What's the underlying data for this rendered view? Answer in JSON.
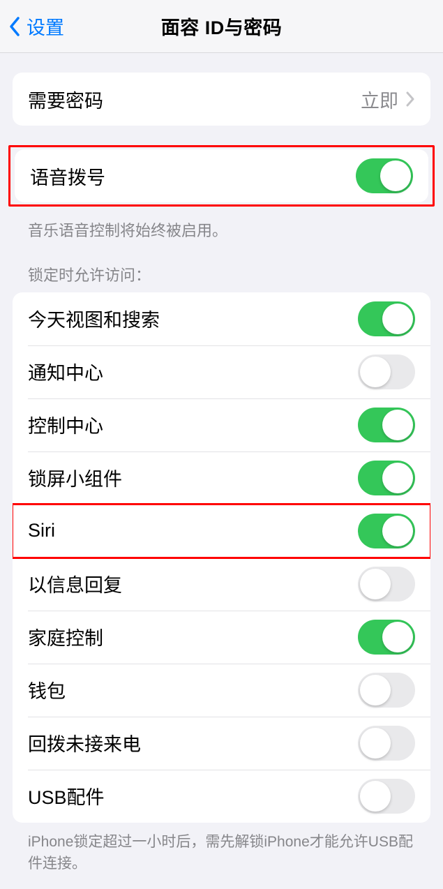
{
  "nav": {
    "back_label": "设置",
    "title": "面容 ID与密码"
  },
  "passcode_group": {
    "require_passcode_label": "需要密码",
    "require_passcode_value": "立即"
  },
  "voice_dial": {
    "label": "语音拨号",
    "on": true,
    "footer": "音乐语音控制将始终被启用。"
  },
  "lock_access": {
    "header": "锁定时允许访问：",
    "items": [
      {
        "label": "今天视图和搜索",
        "on": true
      },
      {
        "label": "通知中心",
        "on": false
      },
      {
        "label": "控制中心",
        "on": true
      },
      {
        "label": "锁屏小组件",
        "on": true
      },
      {
        "label": "Siri",
        "on": true,
        "highlighted": true
      },
      {
        "label": "以信息回复",
        "on": false
      },
      {
        "label": "家庭控制",
        "on": true
      },
      {
        "label": "钱包",
        "on": false
      },
      {
        "label": "回拨未接来电",
        "on": false
      },
      {
        "label": "USB配件",
        "on": false
      }
    ],
    "footer": "iPhone锁定超过一小时后，需先解锁iPhone才能允许USB配件连接。"
  }
}
